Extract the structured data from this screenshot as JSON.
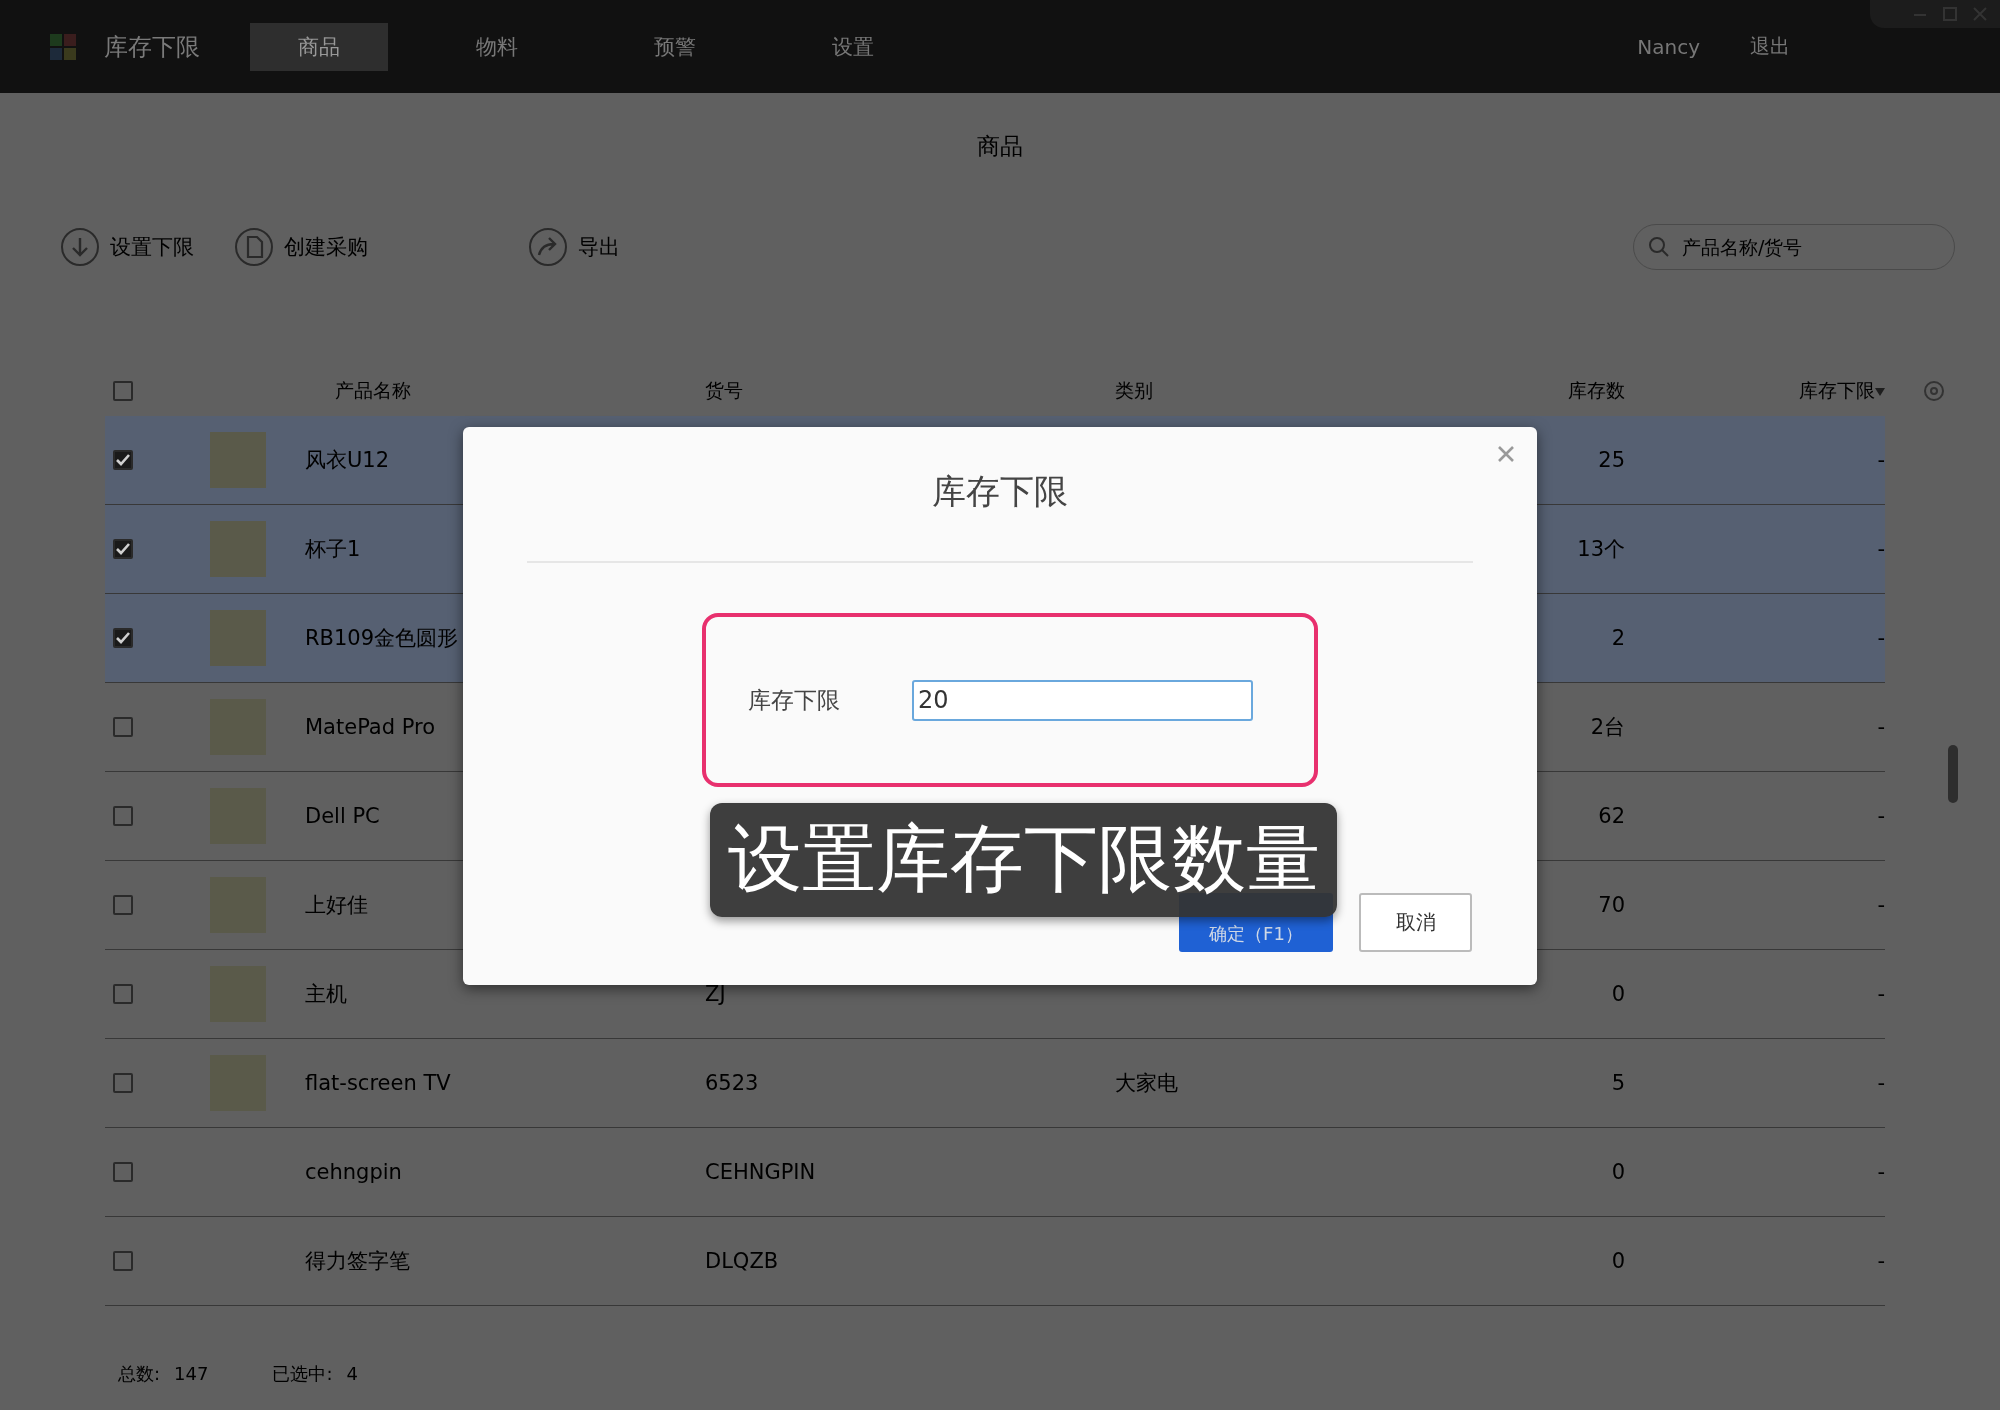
{
  "app": {
    "title": "库存下限"
  },
  "nav_tabs": [
    {
      "label": "商品",
      "selected": true
    },
    {
      "label": "物料",
      "selected": false
    },
    {
      "label": "预警",
      "selected": false
    },
    {
      "label": "设置",
      "selected": false
    }
  ],
  "user": {
    "name": "Nancy",
    "logout": "退出"
  },
  "page_title": "商品",
  "toolbar": [
    {
      "label": "设置下限",
      "kind": "download"
    },
    {
      "label": "创建采购",
      "kind": "document"
    },
    {
      "label": "导出",
      "kind": "share"
    }
  ],
  "search": {
    "placeholder": "产品名称/货号"
  },
  "table": {
    "columns": [
      "产品名称",
      "货号",
      "类别",
      "库存数",
      "库存下限"
    ],
    "all_checked": false,
    "rows": [
      {
        "checked": true,
        "photo": true,
        "name": "风衣U12",
        "stock": "25",
        "min_stock": "-"
      },
      {
        "checked": true,
        "photo": true,
        "name": "杯子1",
        "stock": "13个",
        "min_stock": "-"
      },
      {
        "checked": true,
        "photo": true,
        "name": "RB109金色圆形",
        "stock": "2",
        "min_stock": "-"
      },
      {
        "checked": false,
        "photo": true,
        "name": "MatePad Pro",
        "stock": "2台",
        "min_stock": "-"
      },
      {
        "checked": false,
        "photo": true,
        "name": "Dell PC",
        "stock": "62",
        "min_stock": "-"
      },
      {
        "checked": false,
        "photo": true,
        "name": "上好佳",
        "stock": "70",
        "min_stock": "-"
      },
      {
        "checked": false,
        "photo": true,
        "name": "主机",
        "code": "ZJ",
        "stock": "0",
        "min_stock": "-"
      },
      {
        "checked": false,
        "photo": true,
        "name": "flat-screen TV",
        "code": "6523",
        "category": "大家电",
        "stock": "5",
        "min_stock": "-"
      },
      {
        "checked": false,
        "photo": false,
        "name": "cehngpin",
        "code": "CEHNGPIN",
        "stock": "0",
        "min_stock": "-"
      },
      {
        "checked": false,
        "photo": false,
        "name": "得力签字笔",
        "code": "DLQZB",
        "stock": "0",
        "min_stock": "-"
      }
    ]
  },
  "footer": {
    "total_label": "总数:",
    "total": "147",
    "selected_label": "已选中:",
    "selected": "4"
  },
  "dialog": {
    "title": "库存下限",
    "field_label": "库存下限",
    "field_value": "20",
    "buttons": [
      {
        "label": "确定（F1）",
        "kind": "primary"
      },
      {
        "label": "取消",
        "kind": "secondary"
      }
    ]
  },
  "caption": "设置库存下限数量"
}
